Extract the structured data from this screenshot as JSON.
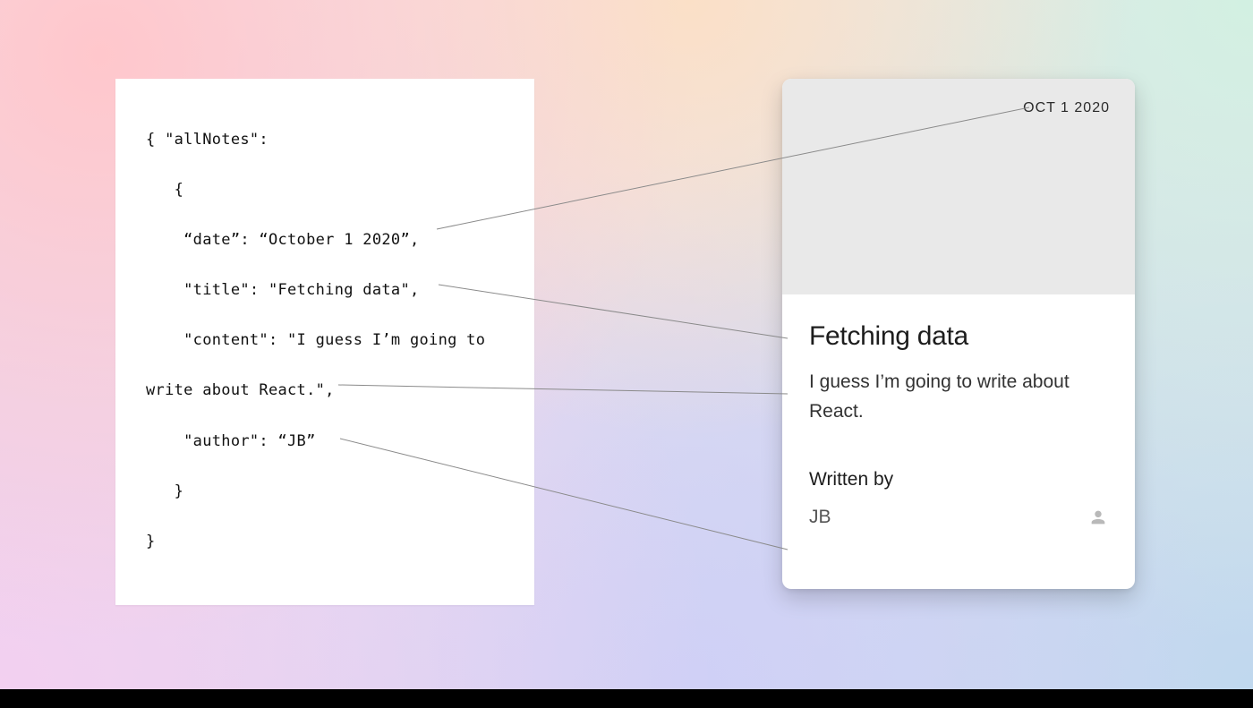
{
  "code": {
    "l1": "{ \"allNotes\":",
    "l2": "",
    "l3": "   {",
    "l4": "",
    "l5": "    “date”: “October 1 2020”,",
    "l6": "",
    "l7": "    \"title\": \"Fetching data\",",
    "l8": "",
    "l9": "    \"content\": \"I guess I’m going to",
    "l10": "",
    "l11": "write about React.\",",
    "l12": "",
    "l13": "    \"author\": “JB”",
    "l14": "",
    "l15": "   }",
    "l16": "",
    "l17": "}"
  },
  "card": {
    "date": "OCT 1 2020",
    "title": "Fetching data",
    "content": "I guess I’m going to write about React.",
    "written_by_label": "Written by",
    "author": "JB"
  }
}
